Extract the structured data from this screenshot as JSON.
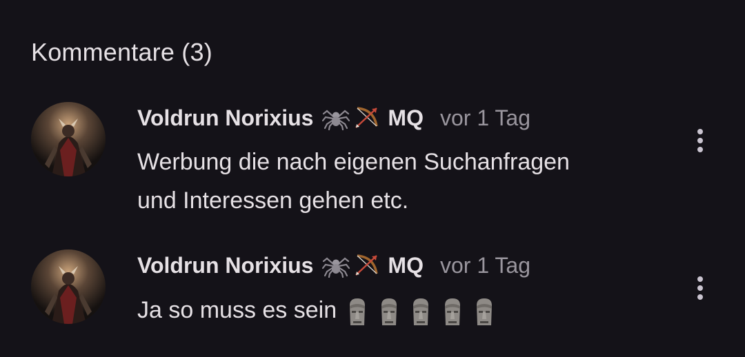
{
  "section": {
    "title": "Kommentare (3)"
  },
  "comments": [
    {
      "author": "Voldrun Norixius",
      "badge_icons": [
        "spider-icon",
        "bow-and-arrow-icon"
      ],
      "badge_text": "MQ",
      "time": "vor 1 Tag",
      "lines": [
        "Werbung die nach eigenen Suchanfragen",
        "und Interessen gehen etc."
      ]
    },
    {
      "author": "Voldrun Norixius",
      "badge_icons": [
        "spider-icon",
        "bow-and-arrow-icon"
      ],
      "badge_text": "MQ",
      "time": "vor 1 Tag",
      "text": "Ja so muss es sein",
      "emojis": [
        "moai-icon",
        "moai-icon",
        "moai-icon",
        "moai-icon",
        "moai-icon"
      ]
    }
  ],
  "colors": {
    "background": "#141218",
    "text_primary": "#e6e1e5",
    "text_secondary": "#9a969e",
    "menu_dots": "#cac4d0"
  }
}
